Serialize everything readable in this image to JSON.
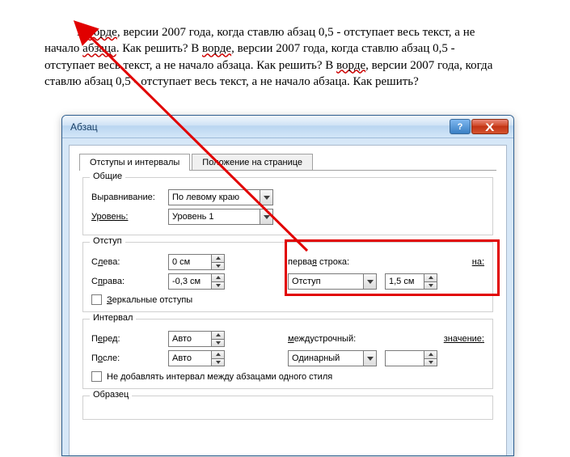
{
  "document": {
    "text": "В ворде, версии 2007 года, когда ставлю абзац 0,5 - отступает весь текст, а не начало абзаца. Как решить? В ворде, версии 2007 года, когда ставлю абзац 0,5 - отступает весь текст, а не начало абзаца. Как решить? В ворде, версии 2007 года, когда ставлю абзац 0,5 - отступает весь текст, а не начало абзаца. Как решить?"
  },
  "dialog": {
    "title": "Абзац",
    "help_symbol": "?",
    "close_symbol": "X",
    "tabs": {
      "indents": "Отступы и интервалы",
      "position": "Положение на странице"
    },
    "general": {
      "title": "Общие",
      "align_label": "Выравнивание:",
      "align_value": "По левому краю",
      "level_label": "Уровень:",
      "level_value": "Уровень 1"
    },
    "indent": {
      "title": "Отступ",
      "left_label": "Слева:",
      "left_value": "0 см",
      "right_label": "Справа:",
      "right_value": "-0,3 см",
      "firstline_label": "первая строка:",
      "firstline_value": "Отступ",
      "by_label": "на:",
      "by_value": "1,5 см",
      "mirror_label": "Зеркальные отступы"
    },
    "spacing": {
      "title": "Интервал",
      "before_label": "Перед:",
      "before_value": "Авто",
      "after_label": "После:",
      "after_value": "Авто",
      "linesp_label": "междустрочный:",
      "linesp_value": "Одинарный",
      "at_label": "значение:",
      "at_value": "",
      "nospace_label": "Не добавлять интервал между абзацами одного стиля"
    },
    "sample_title": "Образец"
  }
}
